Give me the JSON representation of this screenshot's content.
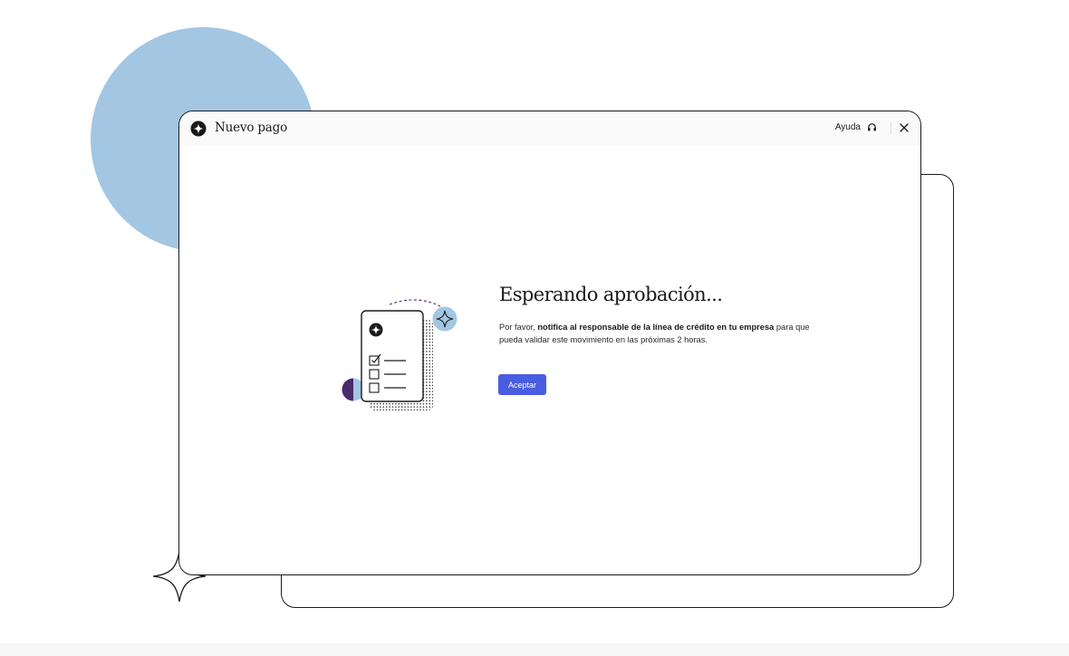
{
  "window": {
    "title": "Nuevo pago",
    "help_label": "Ayuda"
  },
  "icons": {
    "app_logo": "sparkle-circle-icon",
    "help": "headset-icon",
    "close": "close-icon"
  },
  "main": {
    "heading": "Esperando aprobación...",
    "message_prefix": "Por favor, ",
    "message_bold": "notifica al responsable de la línea de crédito en tu empresa",
    "message_suffix": " para que pueda validar este movimiento en las próximas 2 horas.",
    "accept_label": "Aceptar"
  },
  "colors": {
    "accent": "#4a5ce0",
    "decor_blue": "#a3c6e3",
    "decor_purple": "#4b2a6e"
  }
}
